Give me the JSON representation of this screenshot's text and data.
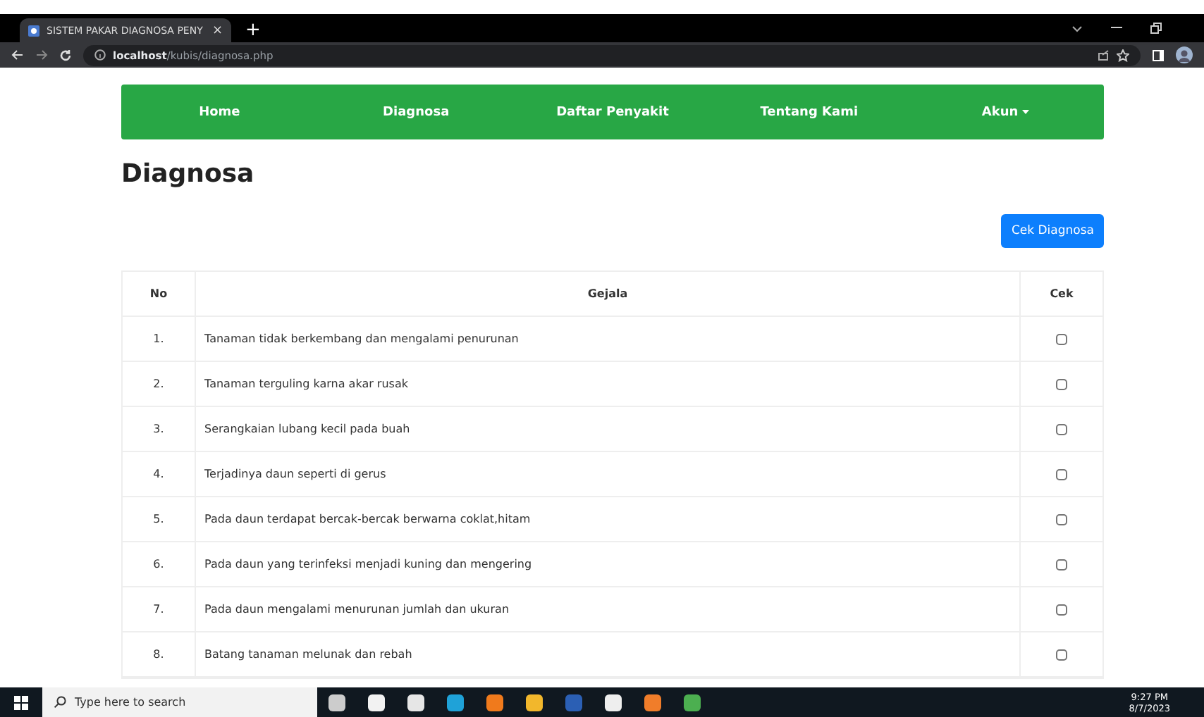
{
  "browser": {
    "tab_title": "SISTEM PAKAR DIAGNOSA PENY",
    "tab_close": "×",
    "new_tab": "+",
    "url_host": "localhost",
    "url_path": "/kubis/diagnosa.php"
  },
  "nav": {
    "items": [
      {
        "label": "Home",
        "dropdown": false
      },
      {
        "label": "Diagnosa",
        "dropdown": false
      },
      {
        "label": "Daftar Penyakit",
        "dropdown": false
      },
      {
        "label": "Tentang Kami",
        "dropdown": false
      },
      {
        "label": "Akun",
        "dropdown": true
      }
    ]
  },
  "page": {
    "title": "Diagnosa",
    "button": "Cek Diagnosa"
  },
  "table": {
    "columns": [
      "No",
      "Gejala",
      "Cek"
    ],
    "rows": [
      {
        "no": "1.",
        "gejala": "Tanaman tidak berkembang dan mengalami penurunan",
        "checked": false
      },
      {
        "no": "2.",
        "gejala": "Tanaman terguling karna akar rusak",
        "checked": false
      },
      {
        "no": "3.",
        "gejala": "Serangkaian lubang kecil pada buah",
        "checked": false
      },
      {
        "no": "4.",
        "gejala": "Terjadinya daun seperti di gerus",
        "checked": false
      },
      {
        "no": "5.",
        "gejala": "Pada daun terdapat bercak-bercak berwarna coklat,hitam",
        "checked": false
      },
      {
        "no": "6.",
        "gejala": "Pada daun yang terinfeksi menjadi kuning dan mengering",
        "checked": false
      },
      {
        "no": "7.",
        "gejala": "Pada daun mengalami menurunan jumlah dan ukuran",
        "checked": false
      },
      {
        "no": "8.",
        "gejala": "Batang tanaman melunak dan rebah",
        "checked": false
      }
    ]
  },
  "taskbar": {
    "search_placeholder": "Type here to search",
    "time": "9:27 PM",
    "date": "8/7/2023"
  }
}
